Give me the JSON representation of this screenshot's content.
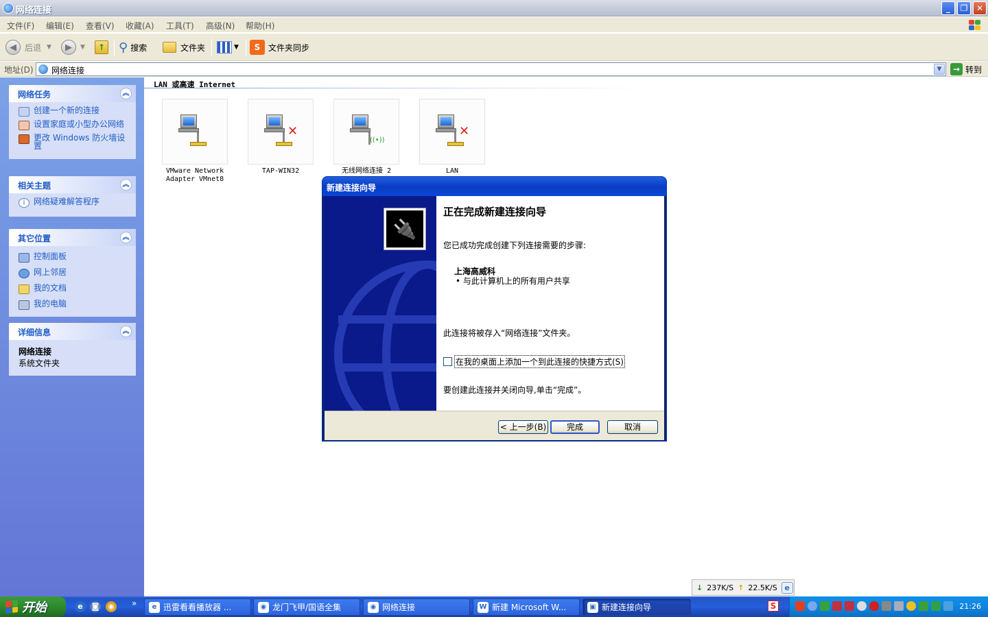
{
  "window": {
    "title": "网络连接",
    "controls": {
      "minimize_icon": "minimize-icon",
      "restore_icon": "restore-icon",
      "close_icon": "close-icon"
    }
  },
  "menu": [
    "文件(F)",
    "编辑(E)",
    "查看(V)",
    "收藏(A)",
    "工具(T)",
    "高级(N)",
    "帮助(H)"
  ],
  "toolbar": {
    "back_label": "后退",
    "search_label": "搜索",
    "folders_label": "文件夹",
    "sync_label": "文件夹同步"
  },
  "address": {
    "label": "地址(D)",
    "value": "网络连接",
    "go_label": "转到"
  },
  "sidebar": {
    "network_tasks": {
      "title": "网络任务",
      "items": [
        "创建一个新的连接",
        "设置家庭或小型办公网络",
        "更改 Windows 防火墙设置"
      ]
    },
    "related": {
      "title": "相关主题",
      "items": [
        "网络疑难解答程序"
      ]
    },
    "other_places": {
      "title": "其它位置",
      "items": [
        "控制面板",
        "网上邻居",
        "我的文档",
        "我的电脑"
      ]
    },
    "details": {
      "title": "详细信息",
      "name": "网络连接",
      "type": "系统文件夹"
    }
  },
  "content": {
    "group_header": "LAN 或高速 Internet",
    "connections": [
      {
        "label": "VMware Network Adapter VMnet8",
        "status": "connected"
      },
      {
        "label": "TAP-WIN32",
        "status": "disconnected"
      },
      {
        "label": "无线网络连接 2",
        "status": "wireless"
      },
      {
        "label": "LAN",
        "status": "disconnected"
      }
    ]
  },
  "wizard": {
    "title": "新建连接向导",
    "heading": "正在完成新建连接向导",
    "intro": "您已成功完成创建下列连接需要的步骤:",
    "connection_name": "上海高威科",
    "bullet": "• 与此计算机上的所有用户共享",
    "saved_note": "此连接将被存入“网络连接”文件夹。",
    "checkbox_label": "在我的桌面上添加一个到此连接的快捷方式(S)",
    "checkbox_checked": false,
    "finish_note": "要创建此连接并关闭向导,单击“完成”。",
    "back_button": "< 上一步(B)",
    "finish_button": "完成",
    "cancel_button": "取消"
  },
  "netmeter": {
    "down": "237K/S",
    "up": "22.5K/S"
  },
  "taskbar": {
    "start_label": "开始",
    "overflow": "»",
    "tasks": [
      "迅雷看看播放器 ...",
      "龙门飞甲/国语全集",
      "网络连接",
      "新建 Microsoft W...",
      "新建连接向导"
    ],
    "ime": "S",
    "clock": "21:26"
  },
  "colors": {
    "xp_blue": "#245edb",
    "sidebar_gradient_top": "#7ba2e7",
    "link_blue": "#215dc6",
    "start_green": "#2e8a2e"
  }
}
